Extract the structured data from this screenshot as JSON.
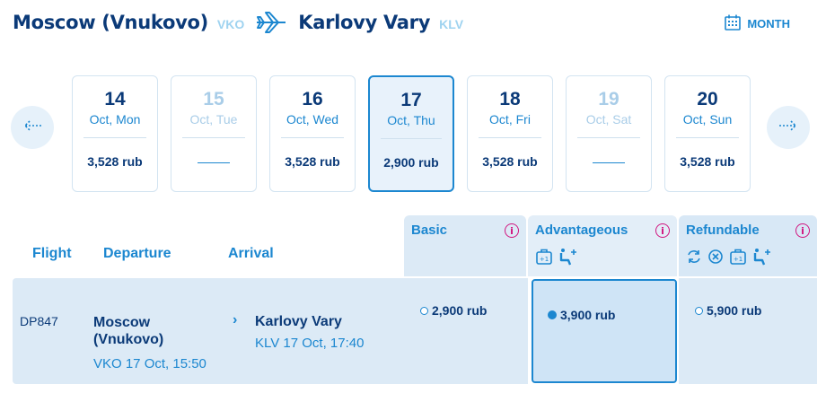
{
  "route": {
    "origin": "Moscow (Vnukovo)",
    "origin_code": "VKO",
    "destination": "Karlovy Vary",
    "destination_code": "KLV",
    "plane_icon": "plane-icon"
  },
  "month_button": {
    "label": "MONTH",
    "icon": "calendar-icon"
  },
  "nav": {
    "prev_icon": "arrow-left-icon",
    "next_icon": "arrow-right-icon"
  },
  "days": [
    {
      "num": "14",
      "label": "Oct, Mon",
      "price": "3,528 rub",
      "available": true,
      "selected": false
    },
    {
      "num": "15",
      "label": "Oct, Tue",
      "price": "",
      "available": false,
      "selected": false
    },
    {
      "num": "16",
      "label": "Oct, Wed",
      "price": "3,528 rub",
      "available": true,
      "selected": false
    },
    {
      "num": "17",
      "label": "Oct, Thu",
      "price": "2,900 rub",
      "available": true,
      "selected": true
    },
    {
      "num": "18",
      "label": "Oct, Fri",
      "price": "3,528 rub",
      "available": true,
      "selected": false
    },
    {
      "num": "19",
      "label": "Oct, Sat",
      "price": "",
      "available": false,
      "selected": false
    },
    {
      "num": "20",
      "label": "Oct, Sun",
      "price": "3,528 rub",
      "available": true,
      "selected": false
    }
  ],
  "table": {
    "col_flight": "Flight",
    "col_departure": "Departure",
    "col_arrival": "Arrival",
    "fares": [
      {
        "name": "Basic",
        "info": "i",
        "icons": []
      },
      {
        "name": "Advantageous",
        "info": "i",
        "icons": [
          "extra-baggage-icon",
          "seat-selection-icon"
        ]
      },
      {
        "name": "Refundable",
        "info": "i",
        "icons": [
          "exchange-icon",
          "refund-icon",
          "extra-baggage-icon",
          "seat-selection-icon"
        ]
      }
    ]
  },
  "flight": {
    "number": "DP847",
    "departure_city": "Moscow (Vnukovo)",
    "departure_info": "VKO 17 Oct, 15:50",
    "arrival_city": "Karlovy Vary",
    "arrival_info": "KLV 17 Oct, 17:40",
    "prices": [
      {
        "value": "2,900 rub",
        "selected": false
      },
      {
        "value": "3,900 rub",
        "selected": true
      },
      {
        "value": "5,900 rub",
        "selected": false
      }
    ]
  },
  "colors": {
    "primary": "#1c87d0",
    "dark": "#0b3a78",
    "light_bg": "#dceaf6",
    "info": "#d1157f"
  }
}
